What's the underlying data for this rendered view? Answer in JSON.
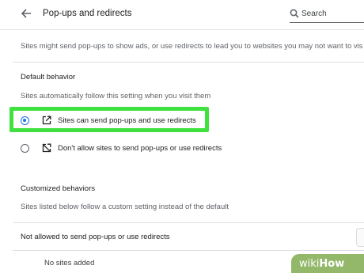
{
  "header": {
    "title": "Pop-ups and redirects",
    "search_placeholder": "Search"
  },
  "description": "Sites might send pop-ups to show ads, or use redirects to lead you to websites you may not want to vis",
  "default_behavior": {
    "title": "Default behavior",
    "description": "Sites automatically follow this setting when you visit them",
    "options": [
      {
        "label": "Sites can send pop-ups and use redirects",
        "icon": "open-in-new-icon",
        "selected": true
      },
      {
        "label": "Don't allow sites to send pop-ups or use redirects",
        "icon": "popup-blocked-icon",
        "selected": false
      }
    ]
  },
  "customized_behaviors": {
    "title": "Customized behaviors",
    "description": "Sites listed below follow a custom setting instead of the default",
    "not_allowed_title": "Not allowed to send pop-ups or use redirects",
    "empty_text": "No sites added"
  },
  "watermark": {
    "brand_prefix": "wiki",
    "brand_suffix": "How"
  },
  "colors": {
    "accent": "#1a73e8",
    "highlight": "#3fe13f",
    "watermark_bg": "#93b86a"
  }
}
